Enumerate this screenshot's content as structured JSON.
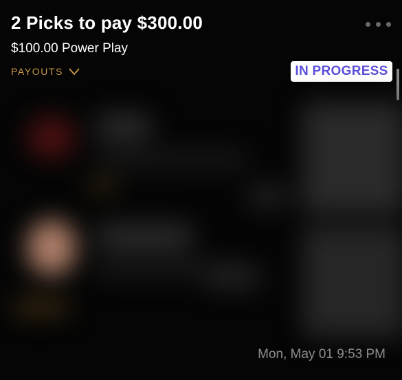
{
  "entry": {
    "title": "2 Picks to pay $300.00",
    "subtitle": "$100.00 Power Play",
    "payouts_label": "PAYOUTS",
    "status": "IN PROGRESS",
    "timestamp": "Mon, May 01 9:53 PM"
  },
  "icons": {
    "more": "more-dots-icon",
    "payouts_toggle": "chevron-down-icon"
  },
  "colors": {
    "background": "#000000",
    "accent_gold": "#c99a45",
    "status_text": "#5b4fd8",
    "status_bg": "#ffffff",
    "muted_text": "#8c8c8c"
  }
}
